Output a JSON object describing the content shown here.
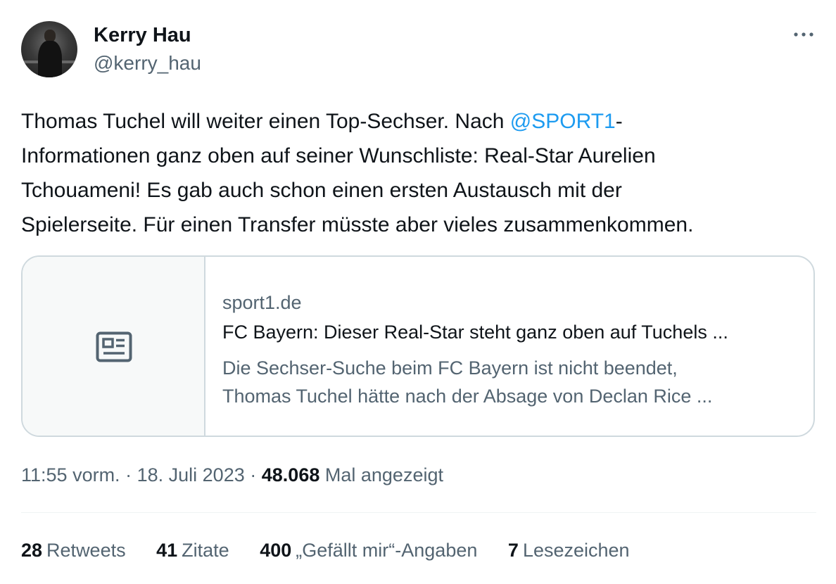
{
  "author": {
    "display_name": "Kerry Hau",
    "handle": "@kerry_hau"
  },
  "tweet": {
    "lines": [
      {
        "before": "Thomas Tuchel will weiter einen Top-Sechser. Nach ",
        "mention": "@SPORT1",
        "after": "-"
      },
      {
        "text": "Informationen ganz oben auf seiner Wunschliste: Real-Star Aurelien"
      },
      {
        "text": "Tchouameni! Es gab auch schon einen ersten Austausch mit der"
      },
      {
        "text": "Spielerseite. Für einen Transfer müsste aber vieles zusammenkommen."
      }
    ]
  },
  "card": {
    "domain": "sport1.de",
    "title": "FC Bayern: Dieser Real-Star steht ganz oben auf Tuchels ...",
    "description_lines": [
      "Die Sechser-Suche beim FC Bayern ist nicht beendet,",
      "Thomas Tuchel hätte nach der Absage von Declan Rice ..."
    ],
    "icon": "newspaper-icon"
  },
  "meta": {
    "time": "11:55 vorm.",
    "separator": "·",
    "date": "18. Juli 2023",
    "views_count": "48.068",
    "views_label": "Mal angezeigt"
  },
  "stats": [
    {
      "count": "28",
      "label": "Retweets"
    },
    {
      "count": "41",
      "label": "Zitate"
    },
    {
      "count": "400",
      "label": "„Gefällt mir“-Angaben"
    },
    {
      "count": "7",
      "label": "Lesezeichen"
    }
  ],
  "icons": {
    "more": "more-options-icon"
  },
  "colors": {
    "text": "#0f1419",
    "secondary": "#536471",
    "link": "#1d9bf0",
    "border": "#cfd9de"
  }
}
